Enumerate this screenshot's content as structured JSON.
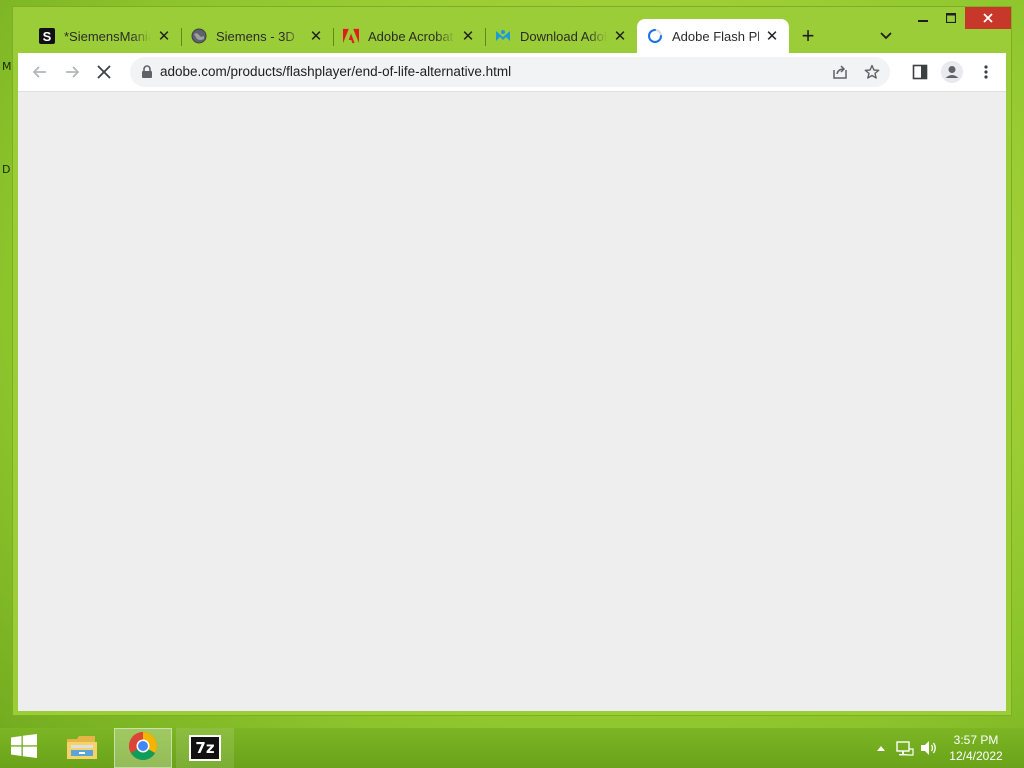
{
  "desktop": {
    "letters": [
      "M",
      "D"
    ]
  },
  "browser": {
    "tabs": [
      {
        "title": "*SiemensMania",
        "icon": "siemensmania-favicon",
        "active": false
      },
      {
        "title": "Siemens - 3D",
        "icon": "globe-icon",
        "active": false
      },
      {
        "title": "Adobe Acrobat",
        "icon": "adobe-icon",
        "active": false
      },
      {
        "title": "Download Adob",
        "icon": "download-site-icon",
        "active": false
      },
      {
        "title": "Adobe Flash Pla",
        "icon": "loading-spinner-icon",
        "active": true
      }
    ],
    "new_tab_label": "+",
    "close_glyph": "✕",
    "address_bar": {
      "url": "adobe.com/products/flashplayer/end-of-life-alternative.html",
      "loading": true
    }
  },
  "taskbar": {
    "clock_time": "3:57 PM",
    "clock_date": "12/4/2022",
    "pinned": [
      "file-explorer-icon",
      "chrome-icon",
      "7zip-icon"
    ],
    "seven_zip_label": "7z"
  },
  "colors": {
    "accent_green": "#8cc42c",
    "close_red": "#c7382b",
    "content_bg": "#eeeeee"
  }
}
